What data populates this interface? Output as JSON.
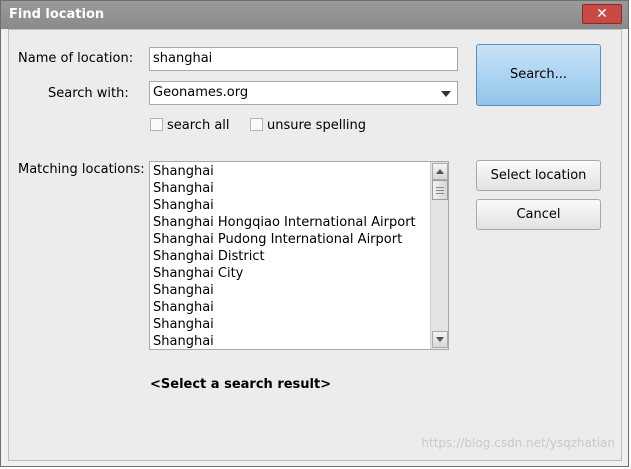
{
  "window": {
    "title": "Find location"
  },
  "labels": {
    "name_of_location": "Name of location:",
    "search_with": "Search with:",
    "matching_locations": "Matching locations:"
  },
  "name_input": {
    "value": "shanghai"
  },
  "search_with_select": {
    "value": "Geonames.org"
  },
  "checkboxes": {
    "search_all": {
      "label": "search all",
      "checked": false
    },
    "unsure_spelling": {
      "label": "unsure spelling",
      "checked": false
    }
  },
  "buttons": {
    "search": "Search...",
    "select_location": "Select location",
    "cancel": "Cancel",
    "close": "✕"
  },
  "results": [
    "Shanghai",
    "Shanghai",
    "Shanghai",
    "Shanghai Hongqiao International Airport",
    "Shanghai Pudong International Airport",
    "Shanghai District",
    "Shanghai City",
    "Shanghai",
    "Shanghai",
    "Shanghai",
    "Shanghai"
  ],
  "status": "<Select a search result>",
  "watermark": "https://blog.csdn.net/ysqzhatian",
  "colors": {
    "title_bar": "#8f8f8f",
    "close_button": "#c94a45",
    "search_button": "#a8d0f0"
  }
}
